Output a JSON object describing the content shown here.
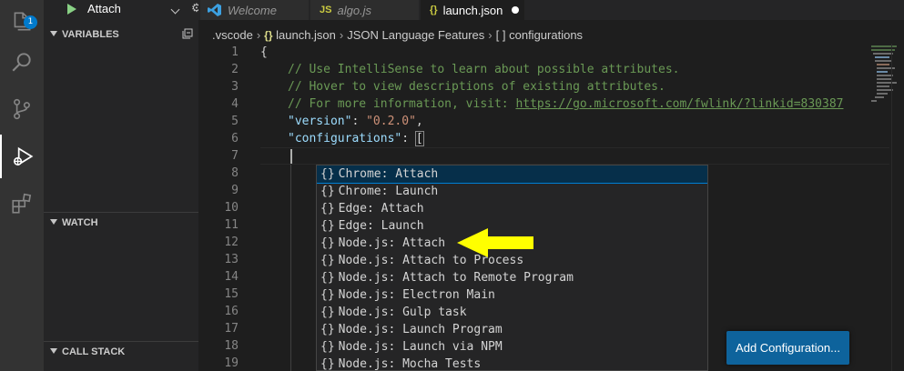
{
  "activity_bar": {
    "explorer_badge": "1",
    "icons": [
      "files-icon",
      "search-icon",
      "source-control-icon",
      "debug-icon",
      "extensions-icon"
    ]
  },
  "debug": {
    "config_selected": "Attach",
    "variables_label": "VARIABLES",
    "watch_label": "WATCH",
    "call_stack_label": "CALL STACK"
  },
  "tabs": [
    {
      "label": "Welcome",
      "icon": "vscode-logo-icon"
    },
    {
      "label": "algo.js",
      "icon_text": "JS"
    },
    {
      "label": "launch.json",
      "icon_text": "{}",
      "modified": true
    }
  ],
  "breadcrumb": {
    "folder": ".vscode",
    "file_icon": "{}",
    "file": "launch.json",
    "section": "JSON Language Features",
    "array_icon": "[ ]",
    "item": "configurations"
  },
  "editor": {
    "line_numbers": [
      "1",
      "2",
      "3",
      "4",
      "5",
      "6",
      "7",
      "8",
      "9",
      "10",
      "11",
      "12",
      "13",
      "14",
      "15",
      "16",
      "17",
      "18",
      "19"
    ],
    "line1": "{",
    "comment1": "// Use IntelliSense to learn about possible attributes.",
    "comment2": "// Hover to view descriptions of existing attributes.",
    "comment3_prefix": "// For more information, visit: ",
    "comment3_link": "https://go.microsoft.com/fwlink/?linkid=830387",
    "version_key": "\"version\"",
    "version_colon": ": ",
    "version_value": "\"0.2.0\"",
    "version_comma": ",",
    "configurations_key": "\"configurations\"",
    "configurations_colon": ": ",
    "configurations_bracket": "["
  },
  "suggestions": {
    "icon": "{}",
    "items": [
      "Chrome: Attach",
      "Chrome: Launch",
      "Edge: Attach",
      "Edge: Launch",
      "Node.js: Attach",
      "Node.js: Attach to Process",
      "Node.js: Attach to Remote Program",
      "Node.js: Electron Main",
      "Node.js: Gulp task",
      "Node.js: Launch Program",
      "Node.js: Launch via NPM",
      "Node.js: Mocha Tests"
    ]
  },
  "add_configuration_label": "Add Configuration...",
  "colors": {
    "accent": "#007acc",
    "arrow": "#ffff00",
    "button": "#0e639c"
  }
}
